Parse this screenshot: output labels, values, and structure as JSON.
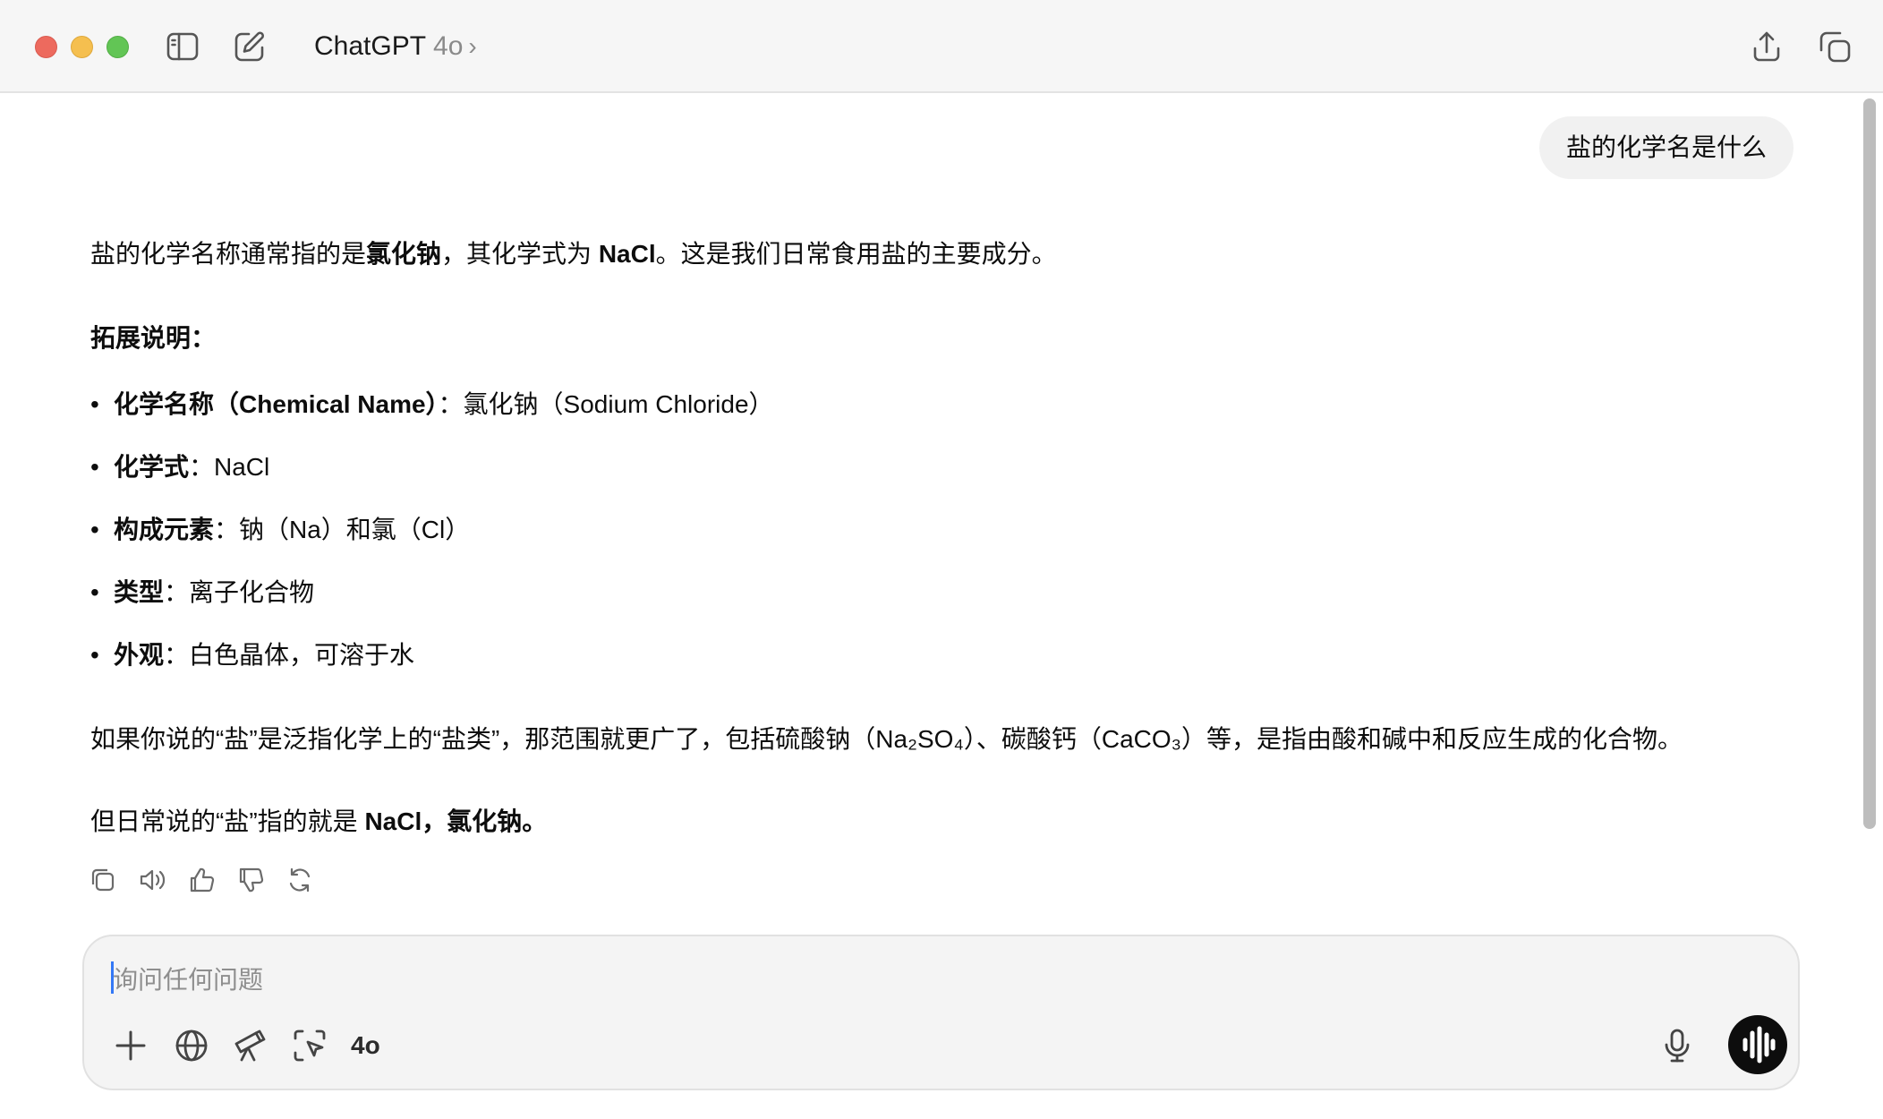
{
  "window": {
    "app_title": "ChatGPT",
    "model": "4o",
    "chevron": "›"
  },
  "toolbar": {
    "icons": [
      "sidebar-toggle-icon",
      "new-chat-icon",
      "share-icon",
      "new-window-icon"
    ]
  },
  "conversation": {
    "user_message": "盐的化学名是什么",
    "answer": {
      "intro_pre": "盐的化学名称通常指的是",
      "intro_b1": "氯化钠",
      "intro_mid": "，其化学式为 ",
      "intro_b2": "NaCl",
      "intro_post": "。这是我们日常食用盐的主要成分。",
      "heading": "拓展说明：",
      "bullets": [
        {
          "label": "化学名称（Chemical Name）",
          "text": "：氯化钠（Sodium Chloride）"
        },
        {
          "label": "化学式",
          "text": "：NaCl"
        },
        {
          "label": "构成元素",
          "text": "：钠（Na）和氯（Cl）"
        },
        {
          "label": "类型",
          "text": "：离子化合物"
        },
        {
          "label": "外观",
          "text": "：白色晶体，可溶于水"
        }
      ],
      "para2": "如果你说的“盐”是泛指化学上的“盐类”，那范围就更广了，包括硫酸钠（Na₂SO₄）、碳酸钙（CaCO₃）等，是指由酸和碱中和反应生成的化合物。",
      "para3_pre": "但日常说的“盐”指的就是 ",
      "para3_b": "NaCl，氯化钠",
      "para3_post": "。"
    },
    "action_icons": [
      "copy-icon",
      "read-aloud-icon",
      "thumbs-up-icon",
      "thumbs-down-icon",
      "regenerate-icon"
    ]
  },
  "composer": {
    "placeholder": "询问任何问题",
    "model_label": "4o",
    "icons": [
      "plus-icon",
      "globe-icon",
      "telescope-icon",
      "screen-select-icon",
      "microphone-icon",
      "voice-mode-icon"
    ]
  }
}
